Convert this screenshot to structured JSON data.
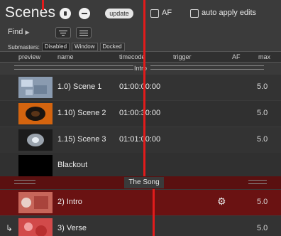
{
  "window": {
    "title": "Scenes"
  },
  "toolbar": {
    "update_label": "update",
    "af_label": "AF",
    "auto_apply_label": "auto apply edits",
    "find_label": "Find"
  },
  "submasters": {
    "label": "Submasters:",
    "options": [
      "Disabled",
      "Window",
      "Docked"
    ],
    "selected": "Disabled"
  },
  "columns": [
    "preview",
    "name",
    "timecode",
    "trigger",
    "AF",
    "max"
  ],
  "groups": [
    {
      "label": "Intro"
    },
    {
      "label": "The Song"
    }
  ],
  "rows": [
    {
      "name": "1.0) Scene 1",
      "timecode": "01:00:00:00",
      "max": "5.0",
      "thumb": "ice-thumb"
    },
    {
      "name": "1.10) Scene 2",
      "timecode": "01:00:30:00",
      "max": "5.0",
      "thumb": "splash-thumb"
    },
    {
      "name": "1.15) Scene 3",
      "timecode": "01:01:00:00",
      "max": "5.0",
      "thumb": "dark-thumb"
    },
    {
      "name": "Blackout",
      "timecode": "",
      "max": "",
      "thumb": "black-thumb"
    },
    {
      "name": "2) Intro",
      "timecode": "",
      "max": "5.0",
      "thumb": "intro-thumb"
    },
    {
      "name": "3) Verse",
      "timecode": "",
      "max": "5.0",
      "thumb": "verse-thumb"
    }
  ],
  "colors": {
    "selected_row": "#6a1212",
    "red_marker": "#e21b1b"
  }
}
